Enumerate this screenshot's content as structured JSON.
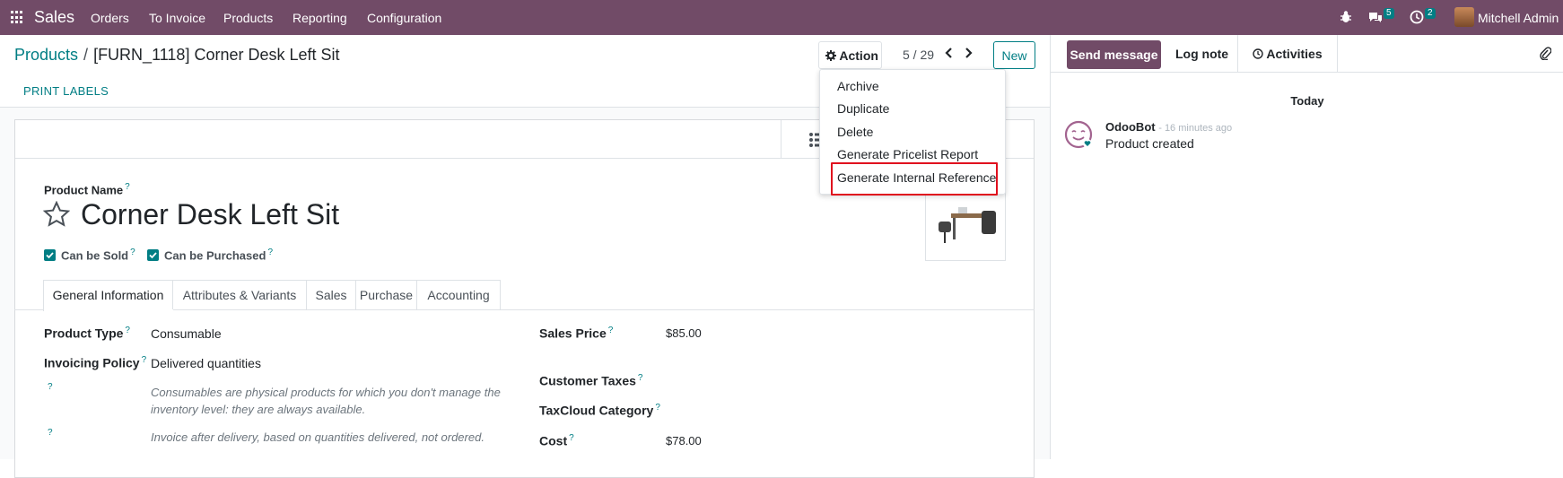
{
  "topbar": {
    "app_name": "Sales",
    "menu": [
      "Orders",
      "To Invoice",
      "Products",
      "Reporting",
      "Configuration"
    ],
    "messages_count": "5",
    "activities_count": "2",
    "user_name": "Mitchell Admin (",
    "bar_color": "#714b67"
  },
  "control_panel": {
    "breadcrumb_parent": "Products",
    "breadcrumb_current": "[FURN_1118] Corner Desk Left Sit",
    "action_label": "Action",
    "pager": "5 / 29",
    "new_label": "New",
    "print_labels": "PRINT LABELS"
  },
  "action_menu": {
    "items": [
      "Archive",
      "Duplicate",
      "Delete",
      "Generate Pricelist Report",
      "Generate Internal Reference"
    ],
    "highlighted": "Generate Internal Reference"
  },
  "form": {
    "product_name_label": "Product Name",
    "product_name": "Corner Desk Left Sit",
    "can_be_sold_label": "Can be Sold",
    "can_be_sold": true,
    "can_be_purchased_label": "Can be Purchased",
    "can_be_purchased": true,
    "help_mark": "?",
    "tabs": [
      "General Information",
      "Attributes & Variants",
      "Sales",
      "Purchase",
      "Accounting"
    ],
    "active_tab": "General Information",
    "product_type_label": "Product Type",
    "product_type": "Consumable",
    "invoicing_policy_label": "Invoicing Policy",
    "invoicing_policy": "Delivered quantities",
    "consumable_help": "Consumables are physical products for which you don't manage the inventory level: they are always available.",
    "invoice_help": "Invoice after delivery, based on quantities delivered, not ordered.",
    "sales_price_label": "Sales Price",
    "sales_price": "$85.00",
    "customer_taxes_label": "Customer Taxes",
    "taxcloud_label": "TaxCloud Category",
    "cost_label": "Cost",
    "cost": "$78.00"
  },
  "chatter": {
    "send_message": "Send message",
    "log_note": "Log note",
    "activities": "Activities",
    "date_separator": "Today",
    "author": "OdooBot",
    "timestamp": "- 16 minutes ago",
    "message": "Product created"
  }
}
